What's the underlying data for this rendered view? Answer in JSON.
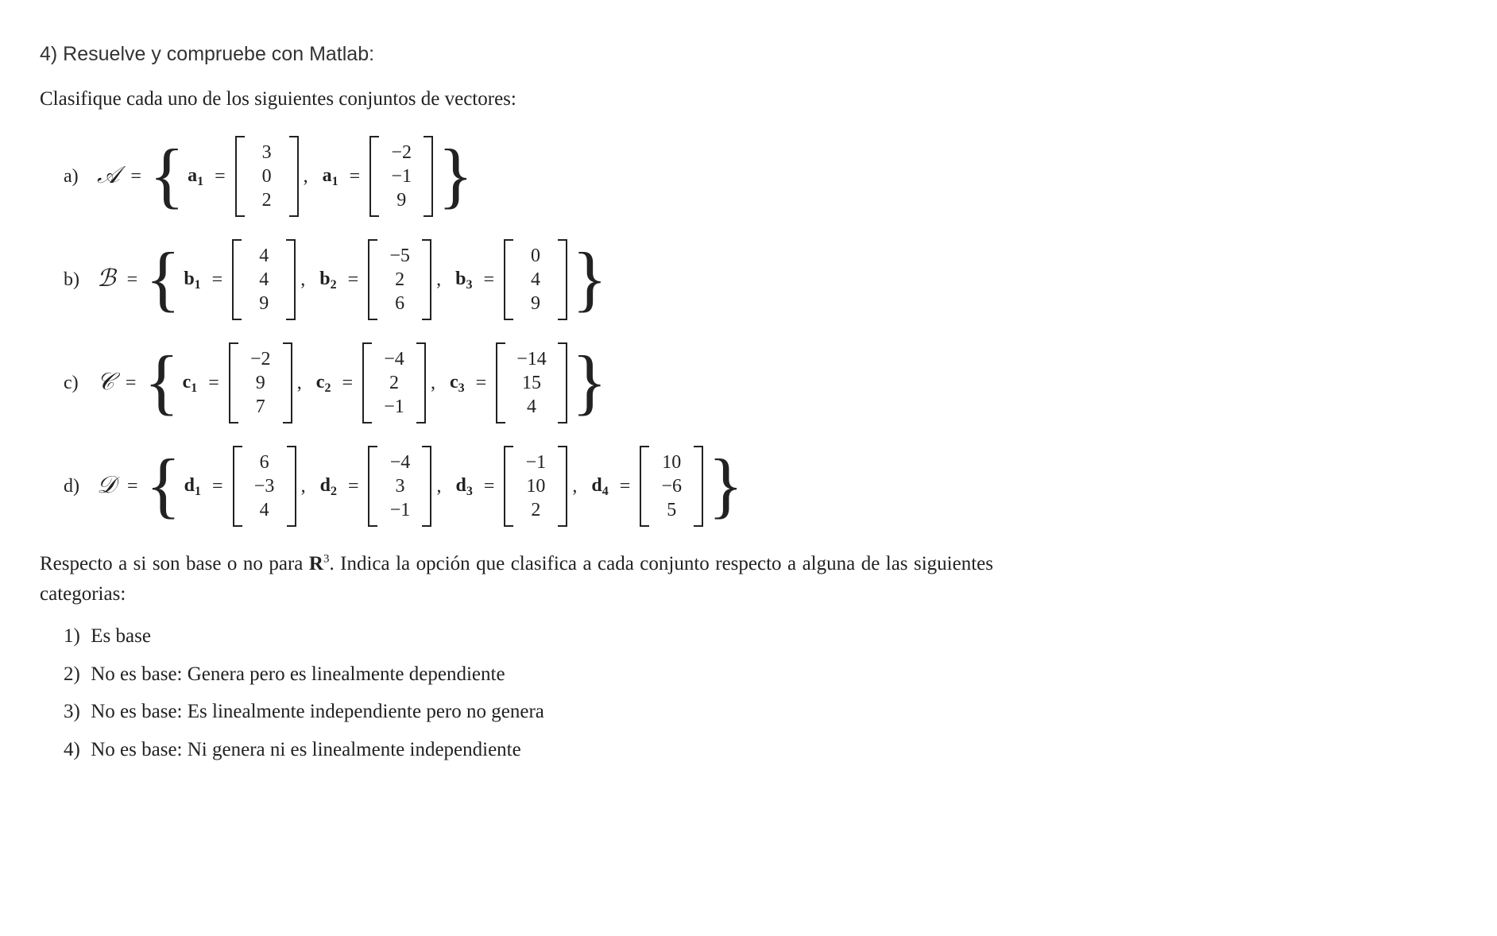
{
  "heading": "4) Resuelve y compruebe con Matlab:",
  "instruction": "Clasifique cada uno de los siguientes conjuntos de vectores:",
  "sets": [
    {
      "label": "a)",
      "letter": "𝒜",
      "vectors": [
        {
          "name": "a",
          "sub": "1",
          "values": [
            "3",
            "0",
            "2"
          ]
        },
        {
          "name": "a",
          "sub": "1",
          "values": [
            "−2",
            "−1",
            "9"
          ]
        }
      ]
    },
    {
      "label": "b)",
      "letter": "ℬ",
      "vectors": [
        {
          "name": "b",
          "sub": "1",
          "values": [
            "4",
            "4",
            "9"
          ]
        },
        {
          "name": "b",
          "sub": "2",
          "values": [
            "−5",
            "2",
            "6"
          ]
        },
        {
          "name": "b",
          "sub": "3",
          "values": [
            "0",
            "4",
            "9"
          ]
        }
      ]
    },
    {
      "label": "c)",
      "letter": "𝒞",
      "vectors": [
        {
          "name": "c",
          "sub": "1",
          "values": [
            "−2",
            "9",
            "7"
          ]
        },
        {
          "name": "c",
          "sub": "2",
          "values": [
            "−4",
            "2",
            "−1"
          ]
        },
        {
          "name": "c",
          "sub": "3",
          "values": [
            "−14",
            "15",
            "4"
          ]
        }
      ]
    },
    {
      "label": "d)",
      "letter": "𝒟",
      "vectors": [
        {
          "name": "d",
          "sub": "1",
          "values": [
            "6",
            "−3",
            "4"
          ]
        },
        {
          "name": "d",
          "sub": "2",
          "values": [
            "−4",
            "3",
            "−1"
          ]
        },
        {
          "name": "d",
          "sub": "3",
          "values": [
            "−1",
            "10",
            "2"
          ]
        },
        {
          "name": "d",
          "sub": "4",
          "values": [
            "10",
            "−6",
            "5"
          ]
        }
      ]
    }
  ],
  "paragraph_pre": "Respecto a si son base o no para ",
  "paragraph_space": "R",
  "paragraph_exp": "3",
  "paragraph_post": ". Indica la opción que clasifica a cada conjunto respecto a alguna de las siguientes categorias:",
  "categories": [
    {
      "num": "1)",
      "text": "Es base"
    },
    {
      "num": "2)",
      "text": "No es base: Genera pero es linealmente dependiente"
    },
    {
      "num": "3)",
      "text": "No es base: Es linealmente independiente pero no genera"
    },
    {
      "num": "4)",
      "text": "No es base: Ni genera ni es linealmente independiente"
    }
  ],
  "eq_sign": "=",
  "comma": ",",
  "lbrace": "{",
  "rbrace": "}"
}
